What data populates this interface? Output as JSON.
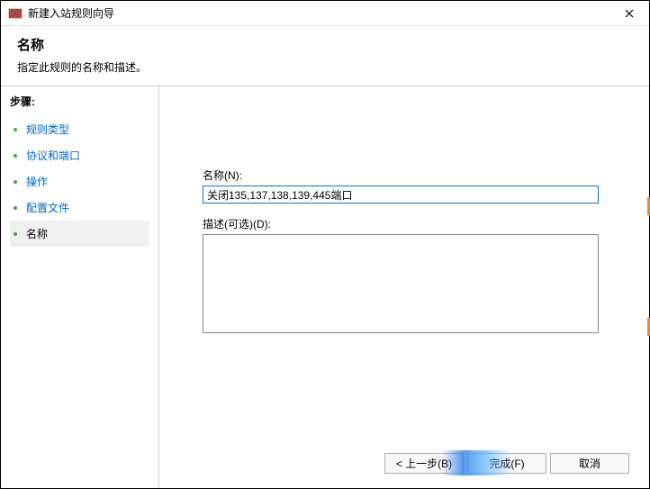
{
  "titlebar": {
    "title": "新建入站规则向导"
  },
  "header": {
    "heading": "名称",
    "sub": "指定此规则的名称和描述。"
  },
  "sidebar": {
    "steps_label": "步骤:",
    "items": [
      {
        "label": "规则类型"
      },
      {
        "label": "协议和端口"
      },
      {
        "label": "操作"
      },
      {
        "label": "配置文件"
      },
      {
        "label": "名称"
      }
    ]
  },
  "form": {
    "name_label": "名称(N):",
    "name_value": "关闭135,137,138,139,445端口",
    "desc_label": "描述(可选)(D):",
    "desc_value": ""
  },
  "footer": {
    "back": "< 上一步(B)",
    "finish": "完成(F)",
    "cancel": "取消"
  }
}
